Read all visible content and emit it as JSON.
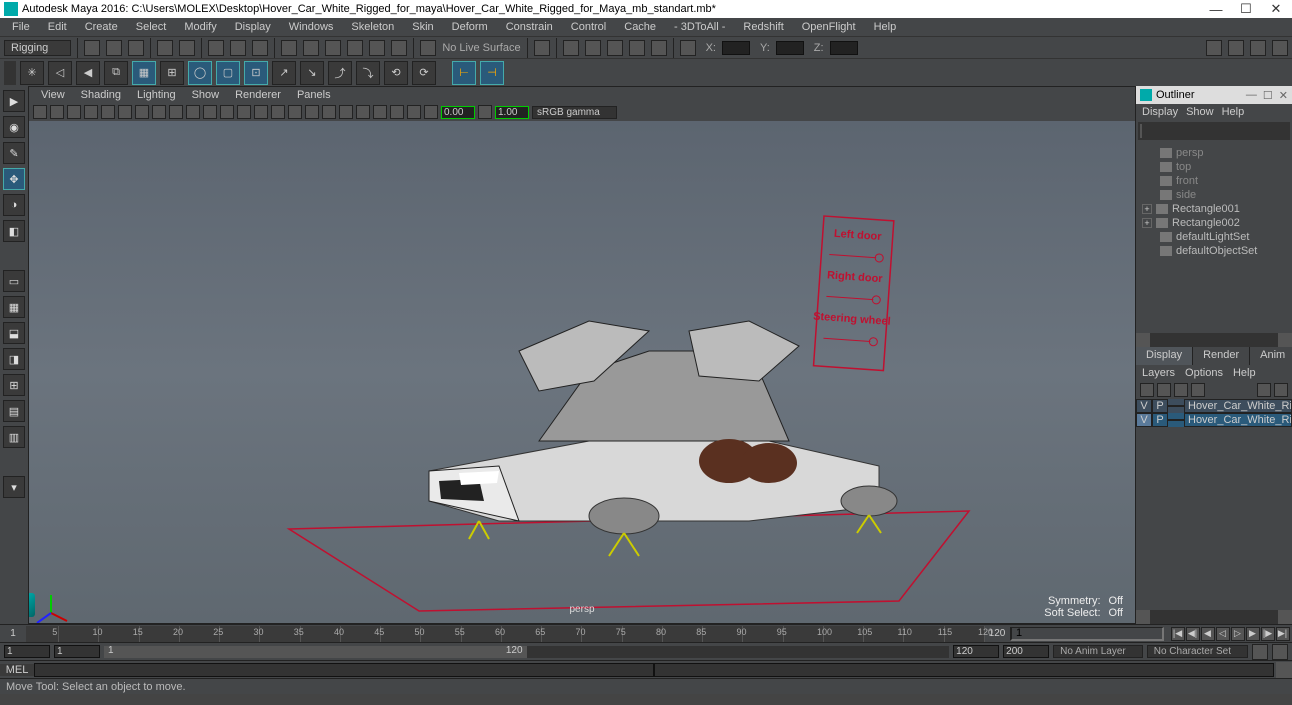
{
  "title": "Autodesk Maya 2016: C:\\Users\\MOLEX\\Desktop\\Hover_Car_White_Rigged_for_maya\\Hover_Car_White_Rigged_for_Maya_mb_standart.mb*",
  "menubar": [
    "File",
    "Edit",
    "Create",
    "Select",
    "Modify",
    "Display",
    "Windows",
    "Skeleton",
    "Skin",
    "Deform",
    "Constrain",
    "Control",
    "Cache",
    "- 3DToAll -",
    "Redshift",
    "OpenFlight",
    "Help"
  ],
  "mode": "Rigging",
  "shelf": {
    "live": "No Live Surface",
    "x": "X:",
    "y": "Y:",
    "z": "Z:"
  },
  "panel_menu": [
    "View",
    "Shading",
    "Lighting",
    "Show",
    "Renderer",
    "Panels"
  ],
  "panel_toolbar": {
    "val1": "0.00",
    "val2": "1.00",
    "gamma": "sRGB gamma"
  },
  "viewport": {
    "camera": "persp",
    "hud": {
      "symmetry": "Symmetry:",
      "symmetry_val": "Off",
      "soft": "Soft Select:",
      "soft_val": "Off"
    },
    "controls": {
      "left_door": "Left door",
      "right_door": "Right door",
      "steering": "Steering wheel"
    }
  },
  "outliner": {
    "title": "Outliner",
    "menu": [
      "Display",
      "Show",
      "Help"
    ],
    "items": [
      {
        "label": "persp",
        "dim": true
      },
      {
        "label": "top",
        "dim": true
      },
      {
        "label": "front",
        "dim": true
      },
      {
        "label": "side",
        "dim": true
      },
      {
        "label": "Rectangle001",
        "exp": true
      },
      {
        "label": "Rectangle002",
        "exp": true
      },
      {
        "label": "defaultLightSet"
      },
      {
        "label": "defaultObjectSet"
      }
    ]
  },
  "tabs": {
    "display": "Display",
    "render": "Render",
    "anim": "Anim"
  },
  "layers": {
    "menu": [
      "Layers",
      "Options",
      "Help"
    ],
    "header": {
      "v": "V",
      "p": "P"
    },
    "rows": [
      {
        "v": "",
        "p": "",
        "swatch": "blue",
        "name": "Hover_Car_White_Rigged"
      },
      {
        "v": "V",
        "p": "P",
        "swatch": "red",
        "name": "Hover_Car_White_Rigged_C",
        "sel": true
      }
    ]
  },
  "timeline": {
    "start": "1",
    "end": "120",
    "range_start_outer": "1",
    "range_start": "1",
    "range_end": "120",
    "range_end_outer": "120",
    "range_extra": "200",
    "animlayer": "No Anim Layer",
    "charset": "No Character Set"
  },
  "mel": "MEL",
  "status": "Move Tool: Select an object to move."
}
